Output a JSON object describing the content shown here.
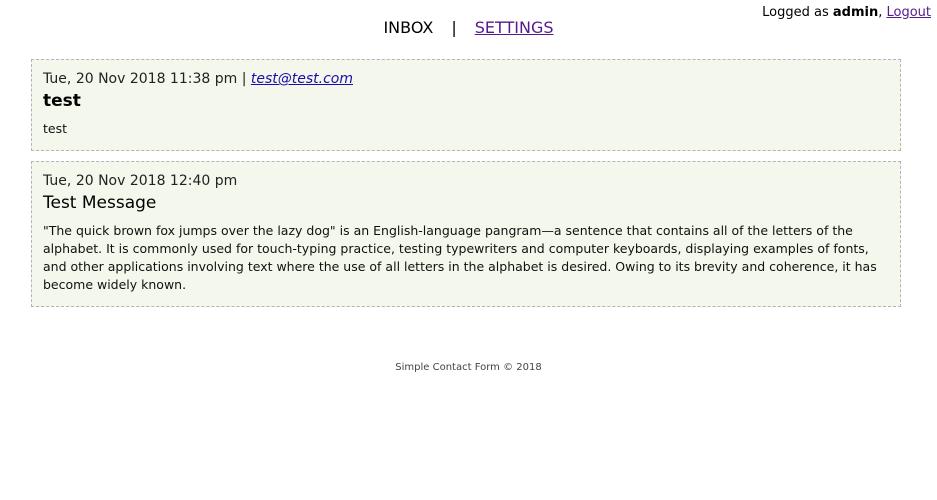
{
  "userbar": {
    "prefix": "Logged as ",
    "username": "admin",
    "separator": ", ",
    "logout_label": "Logout"
  },
  "nav": {
    "inbox_label": "INBOX",
    "separator": "|",
    "settings_label": "SETTINGS"
  },
  "messages": [
    {
      "date": "Tue, 20 Nov 2018 11:38 pm",
      "meta_separator": " | ",
      "email": "test@test.com",
      "subject": "test",
      "body": "test"
    },
    {
      "date": "Tue, 20 Nov 2018 12:40 pm",
      "subject": "Test Message",
      "body": "\"The quick brown fox jumps over the lazy dog\" is an English-language pangram—a sentence that contains all of the letters of the alphabet. It is commonly used for touch-typing practice, testing typewriters and computer keyboards, displaying examples of fonts, and other applications involving text where the use of all letters in the alphabet is desired. Owing to its brevity and coherence, it has become widely known."
    }
  ],
  "footer": {
    "text": "Simple Contact Form © 2018"
  },
  "colors": {
    "message_bg": "#f4f7ec",
    "message_border": "#b4b4b4",
    "visited_link": "#551a8b",
    "link": "#1a0dab"
  }
}
